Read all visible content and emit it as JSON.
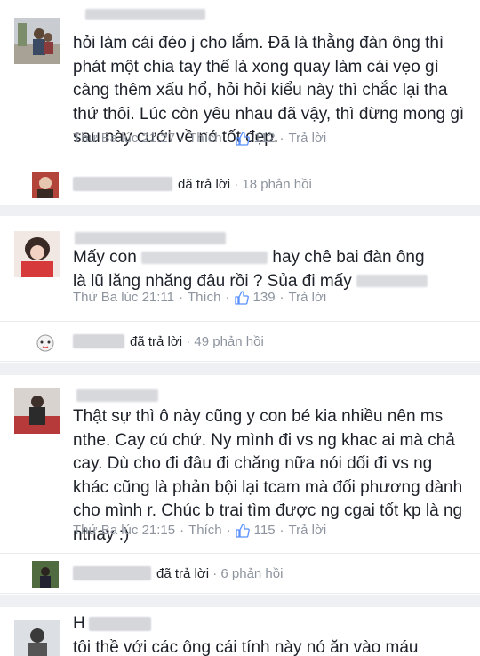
{
  "comments": [
    {
      "text": "hỏi làm cái đéo j cho lắm. Đã là thằng đàn ông thì phát một chia tay thế là xong quay làm cái vẹo gì càng thêm xấu hổ, hỏi hỏi kiểu này thì chắc lại tha thứ thôi. Lúc còn yêu nhau đã vậy, thì đừng mong gì sau này cưới về nó tốt đẹp.",
      "time": "Thứ Ba lúc 21:27",
      "like_label": "Thích",
      "likes": "112",
      "reply_label": "Trả lời",
      "replies_action": "đã trả lời",
      "replies_count": "18 phản hồi"
    },
    {
      "text_a": "Mấy con",
      "text_b": "hay chê bai đàn ông",
      "text_c": "là lũ lăng nhăng đâu rồi ? Sủa đi mấy",
      "time": "Thứ Ba lúc 21:11",
      "like_label": "Thích",
      "likes": "139",
      "reply_label": "Trả lời",
      "replies_action": "đã trả lời",
      "replies_count": "49 phản hồi"
    },
    {
      "text": "Thật sự thì ô này cũng y con bé kia nhiều nên ms nthe. Cay cú chứ. Ny mình đi vs ng khac ai mà chả cay. Dù cho đi đâu đi chăng nữa nói dối đi vs ng khác cũng là phản bội lại tcam mà đối phương dành cho mình r. Chúc b trai tìm được ng cgai tốt kp là ng ntnay :)",
      "time": "Thứ Ba lúc 21:15",
      "like_label": "Thích",
      "likes": "115",
      "reply_label": "Trả lời",
      "replies_action": "đã trả lời",
      "replies_count": "6 phản hồi"
    },
    {
      "name_initial": "H",
      "text": "tôi thề với các ông cái tính này nó ăn vào máu"
    }
  ],
  "colors": {
    "meta": "#8d949e",
    "like_blue": "#5890ff",
    "divider": "#eef0f3"
  }
}
